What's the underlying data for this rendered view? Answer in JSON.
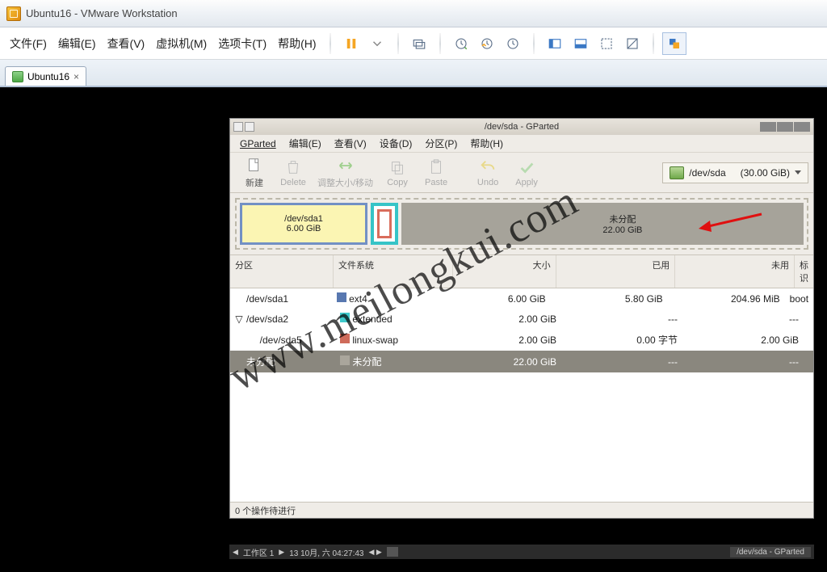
{
  "vmware": {
    "title": "Ubuntu16 - VMware Workstation",
    "menu": {
      "file": "文件(F)",
      "edit": "编辑(E)",
      "view": "查看(V)",
      "vm": "虚拟机(M)",
      "tabs": "选项卡(T)",
      "help": "帮助(H)"
    },
    "tab": {
      "label": "Ubuntu16"
    }
  },
  "gparted": {
    "title": "/dev/sda - GParted",
    "menu": {
      "gparted": "GParted",
      "edit": "编辑(E)",
      "view": "查看(V)",
      "device": "设备(D)",
      "partition": "分区(P)",
      "help": "帮助(H)"
    },
    "toolbar": {
      "new": "新建",
      "delete": "Delete",
      "resize": "调整大小/移动",
      "copy": "Copy",
      "paste": "Paste",
      "undo": "Undo",
      "apply": "Apply"
    },
    "disk": {
      "name": "/dev/sda",
      "size": "(30.00 GiB)"
    },
    "diagram": {
      "sda1_name": "/dev/sda1",
      "sda1_size": "6.00 GiB",
      "unalloc_label": "未分配",
      "unalloc_size": "22.00 GiB"
    },
    "columns": {
      "partition": "分区",
      "filesystem": "文件系统",
      "size": "大小",
      "used": "已用",
      "unused": "未用",
      "flags": "标识"
    },
    "rows": [
      {
        "name": "/dev/sda1",
        "fs": "ext4",
        "fsKey": "ext4",
        "size": "6.00 GiB",
        "used": "5.80 GiB",
        "unused": "204.96 MiB",
        "flags": "boot",
        "indent": 0,
        "exp": ""
      },
      {
        "name": "/dev/sda2",
        "fs": "extended",
        "fsKey": "ext",
        "size": "2.00 GiB",
        "used": "---",
        "unused": "---",
        "flags": "",
        "indent": 0,
        "exp": "▽"
      },
      {
        "name": "/dev/sda5",
        "fs": "linux-swap",
        "fsKey": "swap",
        "size": "2.00 GiB",
        "used": "0.00 字节",
        "unused": "2.00 GiB",
        "flags": "",
        "indent": 1,
        "exp": ""
      },
      {
        "name": "未分配",
        "fs": "未分配",
        "fsKey": "un",
        "size": "22.00 GiB",
        "used": "---",
        "unused": "---",
        "flags": "",
        "indent": 0,
        "exp": "",
        "selected": true
      }
    ],
    "status": "0 个操作待进行"
  },
  "desktop": {
    "workspace": "工作区 1",
    "clock": "13 10月, 六  04:27:43",
    "task": "/dev/sda - GParted"
  },
  "watermark": "www.meilongkui.com"
}
